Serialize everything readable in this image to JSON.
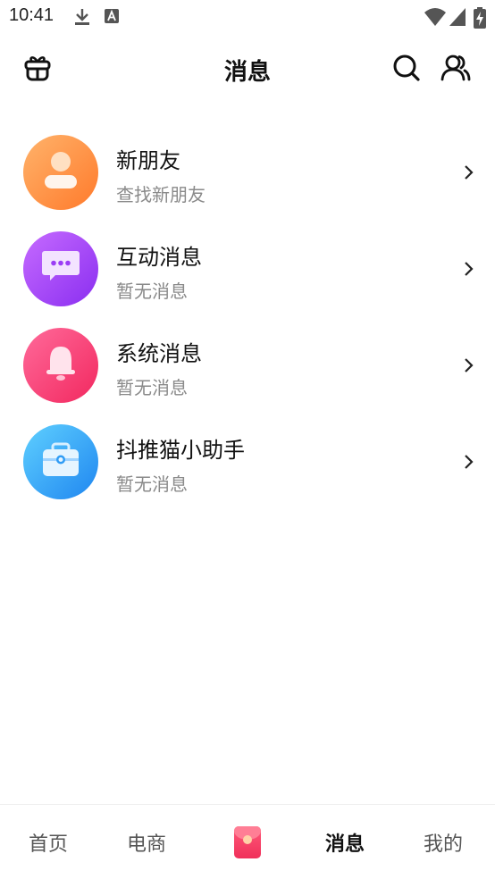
{
  "status_bar": {
    "time": "10:41",
    "icons": [
      "download-icon",
      "text-a-icon",
      "wifi-icon",
      "signal-icon",
      "battery-charging-icon"
    ]
  },
  "header": {
    "title": "消息",
    "left_icon": "gift-box-icon",
    "right_icons": [
      "search-icon",
      "contacts-icon"
    ]
  },
  "messages": [
    {
      "title": "新朋友",
      "subtitle": "查找新朋友",
      "icon": "person-icon",
      "color": "#ff8a3d"
    },
    {
      "title": "互动消息",
      "subtitle": "暂无消息",
      "icon": "chat-bubble-icon",
      "color": "#9b3df5"
    },
    {
      "title": "系统消息",
      "subtitle": "暂无消息",
      "icon": "bell-icon",
      "color": "#ff3d78"
    },
    {
      "title": "抖推猫小助手",
      "subtitle": "暂无消息",
      "icon": "briefcase-icon",
      "color": "#2f9cf5"
    }
  ],
  "tabbar": {
    "tabs": [
      {
        "label": "首页",
        "active": false
      },
      {
        "label": "电商",
        "active": false
      },
      {
        "label": "",
        "icon": "red-packet-icon",
        "active": false
      },
      {
        "label": "消息",
        "active": true
      },
      {
        "label": "我的",
        "active": false
      }
    ]
  }
}
